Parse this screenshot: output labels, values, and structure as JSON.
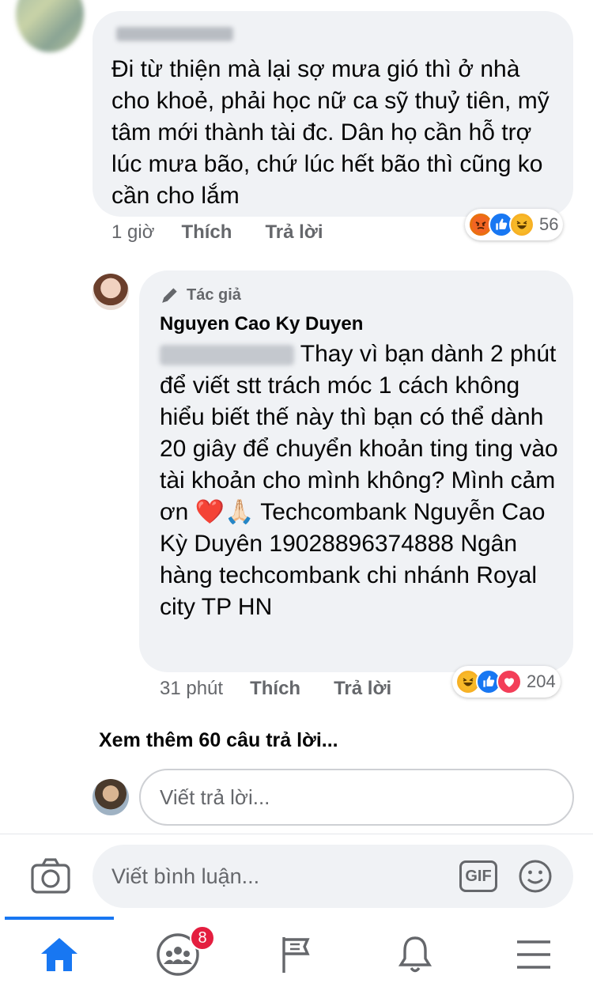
{
  "comment1": {
    "author_name": "",
    "text": "Đi từ thiện mà lại sợ mưa gió thì ở nhà cho khoẻ, phải học nữ ca sỹ thuỷ tiên, mỹ tâm mới thành tài đc. Dân họ cần hỗ trợ lúc mưa bão, chứ lúc hết bão thì cũng ko cần cho lắm",
    "time": "1 giờ",
    "like_label": "Thích",
    "reply_label": "Trả lời",
    "reaction_count": "56",
    "reactions": [
      "angry-icon",
      "like-icon",
      "haha-icon"
    ]
  },
  "reply1": {
    "author_badge": "Tác giả",
    "author_name": "Nguyen Cao Ky Duyen",
    "text": "Thay vì bạn dành 2 phút để viết stt trách móc 1 cách không hiểu biết thế này thì bạn có thể dành 20 giây để chuyển khoản ting ting vào tài khoản cho mình không? Mình cảm ơn ❤️🙏🏻 Techcombank Nguyễn Cao Kỳ Duyên 19028896374888 Ngân hàng techcombank chi nhánh Royal city TP HN",
    "time": "31 phút",
    "like_label": "Thích",
    "reply_label": "Trả lời",
    "reaction_count": "204",
    "reactions": [
      "haha-icon",
      "like-icon",
      "love-icon"
    ]
  },
  "see_more": "Xem thêm 60 câu trả lời...",
  "reply_input": {
    "placeholder": "Viết trả lời..."
  },
  "comment_bar": {
    "placeholder": "Viết bình luận...",
    "gif_label": "GIF"
  },
  "tabbar": {
    "items": [
      "home-icon",
      "groups-icon",
      "pages-icon",
      "notifications-icon",
      "menu-icon"
    ],
    "groups_badge": "8"
  },
  "colors": {
    "accent": "#1877f2",
    "badge": "#e41e3f",
    "bubble": "#f0f2f5",
    "meta": "#65676b"
  }
}
